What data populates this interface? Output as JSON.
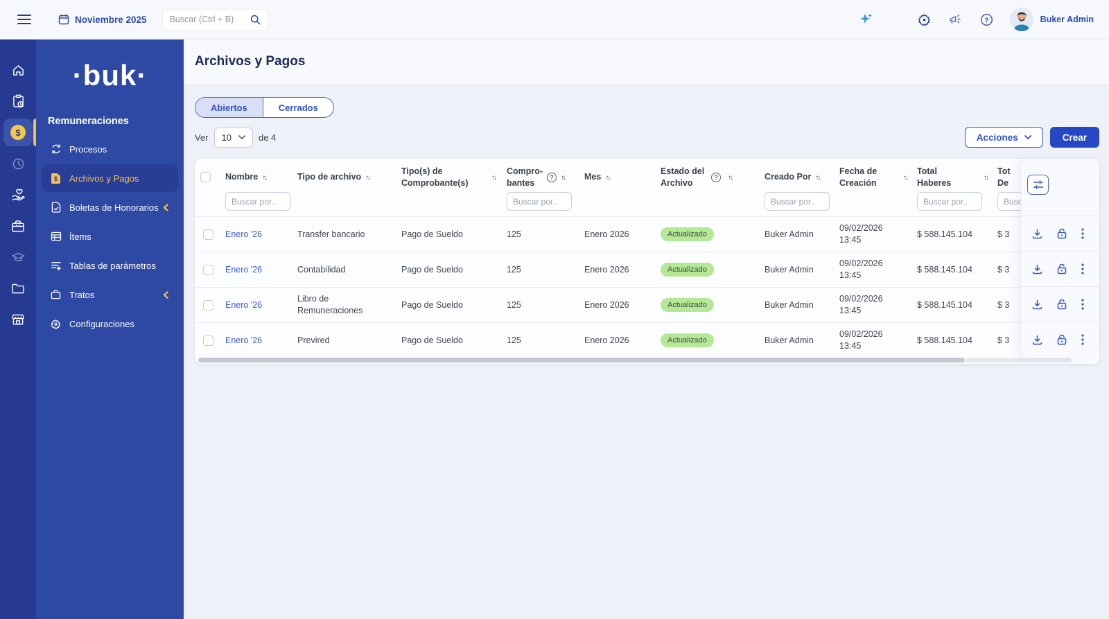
{
  "topbar": {
    "month_label": "Noviembre 2025",
    "search_placeholder": "Buscar (Ctrl + B)",
    "user_name": "Buker Admin"
  },
  "sidebar": {
    "logo": "·buk·",
    "section_title": "Remuneraciones",
    "items": [
      {
        "label": "Procesos",
        "icon": "sync-icon",
        "active": false,
        "chevron": false
      },
      {
        "label": "Archivos y Pagos",
        "icon": "file-dollar-icon",
        "active": true,
        "chevron": false
      },
      {
        "label": "Boletas de Honorarios",
        "icon": "file-check-icon",
        "active": false,
        "chevron": true
      },
      {
        "label": "Ítems",
        "icon": "table-icon",
        "active": false,
        "chevron": false
      },
      {
        "label": "Tablas de parámetros",
        "icon": "list-plus-icon",
        "active": false,
        "chevron": false
      },
      {
        "label": "Tratos",
        "icon": "briefcase-icon",
        "active": false,
        "chevron": true
      },
      {
        "label": "Configuraciones",
        "icon": "gear-icon",
        "active": false,
        "chevron": false
      }
    ],
    "rail_icons": [
      "home-icon",
      "clipboard-clock-icon",
      "coin-dollar-icon",
      "clock-icon",
      "hand-heart-icon",
      "briefcase-icon",
      "graduation-cap-icon",
      "folder-icon",
      "storefront-icon"
    ]
  },
  "page": {
    "title": "Archivos y Pagos",
    "tabs": [
      {
        "label": "Abiertos",
        "active": true
      },
      {
        "label": "Cerrados",
        "active": false
      }
    ],
    "ver_label": "Ver",
    "page_size": "10",
    "total_label": "de 4",
    "actions_label": "Acciones",
    "create_label": "Crear"
  },
  "table": {
    "filter_placeholder": "Buscar por..",
    "sort_glyph": "↑↓",
    "help_glyph": "?",
    "columns": [
      {
        "line1": "Nombre",
        "line2": ""
      },
      {
        "line1": "Tipo de archivo",
        "line2": ""
      },
      {
        "line1": "Tipo(s) de",
        "line2": "Comprobante(s)"
      },
      {
        "line1": "Compro-",
        "line2": "bantes"
      },
      {
        "line1": "Mes",
        "line2": ""
      },
      {
        "line1": "Estado del",
        "line2": "Archivo"
      },
      {
        "line1": "Creado Por",
        "line2": ""
      },
      {
        "line1": "Fecha de",
        "line2": "Creación"
      },
      {
        "line1": "Total",
        "line2": "Haberes"
      },
      {
        "line1": "Tot",
        "line2": "De"
      }
    ],
    "rows": [
      {
        "name": "Enero '26",
        "file_type": "Transfer bancario",
        "voucher_type": "Pago de Sueldo",
        "vouchers": "125",
        "month": "Enero 2026",
        "status": "Actualizado",
        "created_by": "Buker Admin",
        "created_date": "09/02/2026",
        "created_time": "13:45",
        "total_haberes": "$ 588.145.104",
        "total_descuentos": "$ 3"
      },
      {
        "name": "Enero '26",
        "file_type": "Contabilidad",
        "voucher_type": "Pago de Sueldo",
        "vouchers": "125",
        "month": "Enero 2026",
        "status": "Actualizado",
        "created_by": "Buker Admin",
        "created_date": "09/02/2026",
        "created_time": "13:45",
        "total_haberes": "$ 588.145.104",
        "total_descuentos": "$ 3"
      },
      {
        "name": "Enero '26",
        "file_type": "Libro de Remuneraciones",
        "voucher_type": "Pago de Sueldo",
        "vouchers": "125",
        "month": "Enero 2026",
        "status": "Actualizado",
        "created_by": "Buker Admin",
        "created_date": "09/02/2026",
        "created_time": "13:45",
        "total_haberes": "$ 588.145.104",
        "total_descuentos": "$ 3"
      },
      {
        "name": "Enero '26",
        "file_type": "Previred",
        "voucher_type": "Pago de Sueldo",
        "vouchers": "125",
        "month": "Enero 2026",
        "status": "Actualizado",
        "created_by": "Buker Admin",
        "created_date": "09/02/2026",
        "created_time": "13:45",
        "total_haberes": "$ 588.145.104",
        "total_descuentos": "$ 3"
      }
    ]
  },
  "colors": {
    "brand_blue": "#2d4ba8",
    "rail_blue": "#253a90",
    "sidebar_blue": "#2e49a4",
    "accent_yellow": "#f2c14b",
    "primary_button_blue": "#2547c5",
    "link_blue": "#3b5cc9",
    "badge_green_bg": "#b5e895",
    "badge_green_text": "#3c4a52"
  }
}
